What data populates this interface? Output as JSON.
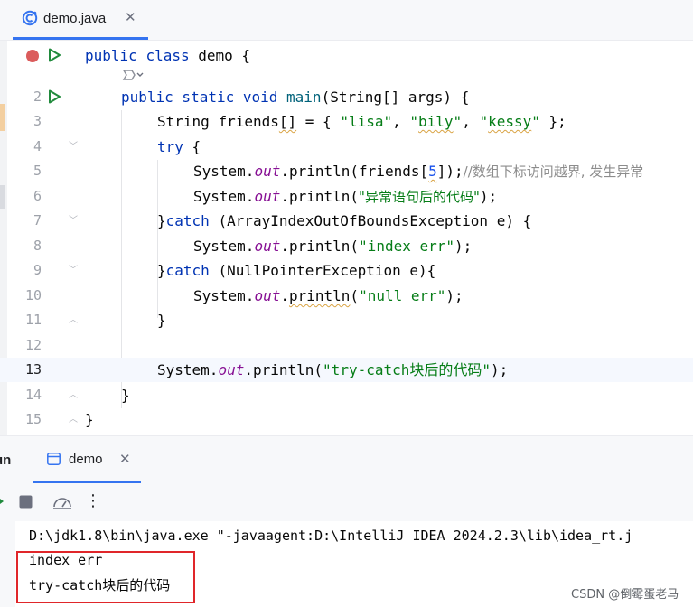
{
  "tab": {
    "file_name": "demo.java",
    "close": "✕",
    "icon": "java-class-icon"
  },
  "editor": {
    "line_numbers": [
      "2",
      "3",
      "4",
      "5",
      "6",
      "7",
      "8",
      "9",
      "10",
      "11",
      "12",
      "13",
      "14",
      "15"
    ],
    "class_decl": {
      "kw1": "public",
      "kw2": "class",
      "name": "demo",
      "brace": " {"
    },
    "main_decl": {
      "mods": "public static void",
      "name": "main",
      "params": "(String[] args) {"
    },
    "line3": {
      "type": "String ",
      "var": "friends",
      "brackets": "[]",
      "eq": " = { ",
      "s1": "\"lisa\"",
      "c1": ", ",
      "s2_q1": "\"",
      "s2": "bily",
      "s2_q2": "\"",
      "c2": ", ",
      "s3_q1": "\"",
      "s3": "kessy",
      "s3_q2": "\"",
      "end": " };"
    },
    "line4": {
      "kw": "try",
      "rest": " {"
    },
    "line5": {
      "sys": "System.",
      "out": "out",
      "call": ".println(friends[",
      "idx": "5",
      "close": "]);",
      "comment": "//数组下标访问越界, 发生异常"
    },
    "line6": {
      "sys": "System.",
      "out": "out",
      "call": ".println(",
      "str": "\"异常语句后的代码\"",
      "end": ");"
    },
    "line7": {
      "brace": "}",
      "kw": "catch",
      "rest": " (ArrayIndexOutOfBoundsException e) {"
    },
    "line8": {
      "sys": "System.",
      "out": "out",
      "call": ".println(",
      "str": "\"index err\"",
      "end": ");"
    },
    "line9": {
      "brace": "}",
      "kw": "catch",
      "rest": " (NullPointerException e){"
    },
    "line10": {
      "sys": "System.",
      "out": "out",
      "dot": ".",
      "call": "println",
      "paren": "(",
      "str": "\"null err\"",
      "end": ");"
    },
    "line11": "}",
    "line13": {
      "sys": "System.",
      "out": "out",
      "call": ".println(",
      "str": "\"try-catch块后的代码\"",
      "end": ");"
    },
    "line14": "}",
    "line15": "}"
  },
  "run_panel": {
    "label": "un",
    "tab_label": "demo",
    "tab_close": "✕",
    "more": "⋮"
  },
  "console": {
    "lines": [
      "D:\\jdk1.8\\bin\\java.exe \"-javaagent:D:\\IntelliJ IDEA 2024.2.3\\lib\\idea_rt.j",
      "index err",
      "try-catch块后的代码"
    ]
  },
  "watermark": "CSDN @倒霉蛋老马",
  "colors": {
    "accent": "#3574f0",
    "highlight_box": "#e0262a",
    "keyword": "#0033b3",
    "string": "#067d17"
  }
}
